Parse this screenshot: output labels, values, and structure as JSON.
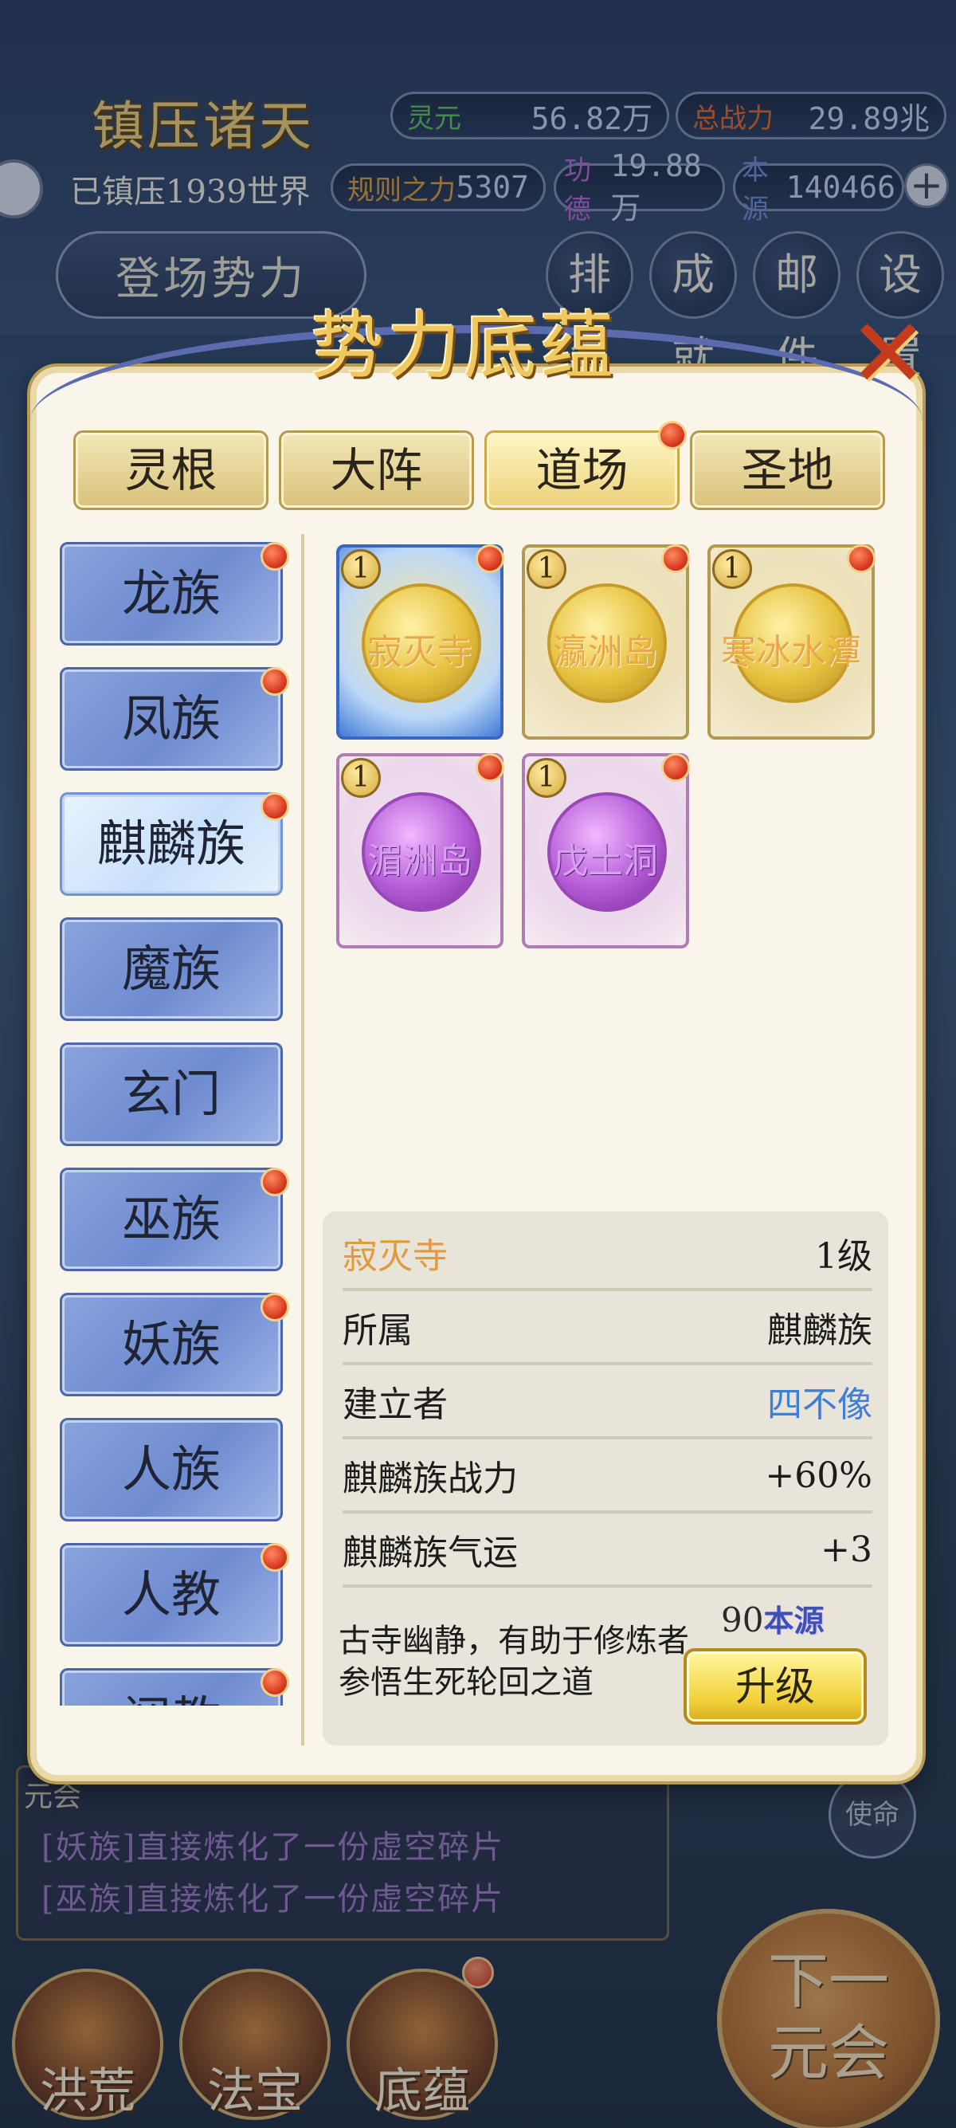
{
  "hud": {
    "title": "镇压诸天",
    "conquered": "已镇压1939世界",
    "resources": [
      {
        "label": "灵元",
        "value": "56.82万",
        "color": "#5cc65a"
      },
      {
        "label": "总战力",
        "value": "29.89兆",
        "color": "#e06a2a"
      },
      {
        "label": "规则之力",
        "value": "5307",
        "color": "#e0a23a"
      },
      {
        "label": "功德",
        "value": "19.88万",
        "color": "#b56ad6"
      },
      {
        "label": "本源",
        "value": "140466",
        "color": "#6e8cd6"
      }
    ],
    "forces_button": "登场势力",
    "top_icons": [
      "排名",
      "成就",
      "邮件",
      "设置"
    ]
  },
  "modal": {
    "title": "势力底蕴",
    "tabs": [
      {
        "label": "灵根",
        "active": false,
        "dot": false
      },
      {
        "label": "大阵",
        "active": false,
        "dot": false
      },
      {
        "label": "道场",
        "active": true,
        "dot": true
      },
      {
        "label": "圣地",
        "active": false,
        "dot": false
      }
    ],
    "races": [
      {
        "label": "龙族",
        "dot": true,
        "active": false
      },
      {
        "label": "凤族",
        "dot": true,
        "active": false
      },
      {
        "label": "麒麟族",
        "dot": true,
        "active": true
      },
      {
        "label": "魔族",
        "dot": false,
        "active": false
      },
      {
        "label": "玄门",
        "dot": false,
        "active": false
      },
      {
        "label": "巫族",
        "dot": true,
        "active": false
      },
      {
        "label": "妖族",
        "dot": true,
        "active": false
      },
      {
        "label": "人族",
        "dot": false,
        "active": false
      },
      {
        "label": "人教",
        "dot": true,
        "active": false
      },
      {
        "label": "阐教",
        "dot": true,
        "active": false
      }
    ],
    "cards": [
      {
        "name": "寂灭寺",
        "level": "1",
        "style": "gold",
        "selected": true
      },
      {
        "name": "瀛洲岛",
        "level": "1",
        "style": "gold",
        "selected": false
      },
      {
        "name": "寒冰水潭",
        "level": "1",
        "style": "gold",
        "selected": false
      },
      {
        "name": "湄洲岛",
        "level": "1",
        "style": "purple",
        "selected": false
      },
      {
        "name": "戊土洞",
        "level": "1",
        "style": "purple",
        "selected": false
      }
    ],
    "detail": {
      "name": "寂灭寺",
      "level": "1级",
      "rows": [
        {
          "key": "所属",
          "value": "麒麟族"
        },
        {
          "key": "建立者",
          "value": "四不像"
        },
        {
          "key": "麒麟族战力",
          "value": "+60%"
        },
        {
          "key": "麒麟族气运",
          "value": "+3"
        }
      ],
      "description": "古寺幽静，有助于修炼者参悟生死轮回之道",
      "cost_amount": "90",
      "cost_unit": "本源",
      "upgrade_label": "升级"
    }
  },
  "log": {
    "title": "元会",
    "lines": [
      "[妖族]直接炼化了一份虚空碎片",
      "[巫族]直接炼化了一份虚空碎片"
    ]
  },
  "mission_label": "使命",
  "next_label_1": "下一",
  "next_label_2": "元会",
  "bottom_nav": [
    "洪荒",
    "法宝",
    "底蕴"
  ]
}
